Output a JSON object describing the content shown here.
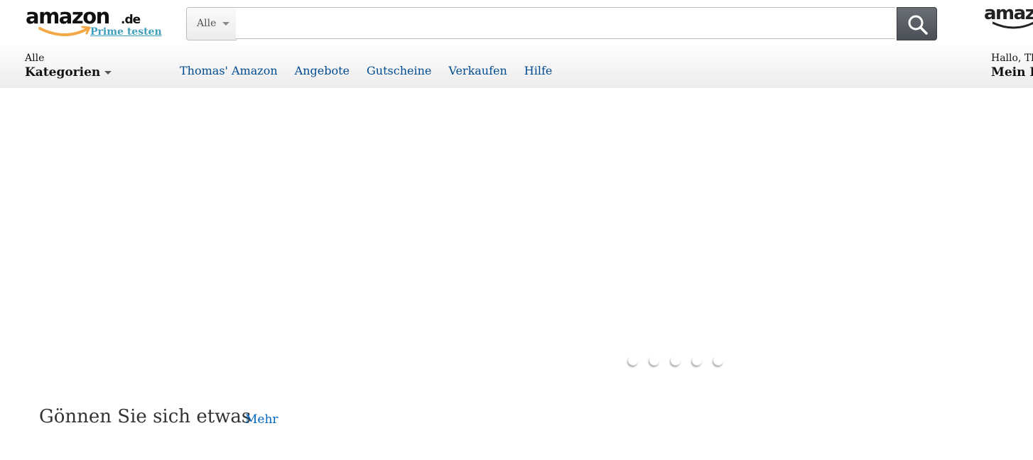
{
  "logo": {
    "word": "amazon",
    "tld": ".de",
    "prime_link": "Prime testen"
  },
  "search": {
    "department": "Alle",
    "placeholder": "",
    "value": "",
    "button_icon": "search-icon"
  },
  "right_logo": {
    "word": "amazon"
  },
  "categories": {
    "line1": "Alle",
    "line2": "Kategorien"
  },
  "nav": {
    "links": [
      "Thomas' Amazon",
      "Angebote",
      "Gutscheine",
      "Verkaufen",
      "Hilfe"
    ]
  },
  "account": {
    "line1": "Hallo, Th",
    "line2": "Mein K"
  },
  "carousel": {
    "dot_count": 5
  },
  "section": {
    "title": "Gönnen Sie sich etwas",
    "more": "Mehr"
  },
  "colors": {
    "link": "#004b91",
    "prime": "#3f9fbb",
    "logo_smile": "#f3a847",
    "search_button": "#5a5e65"
  }
}
